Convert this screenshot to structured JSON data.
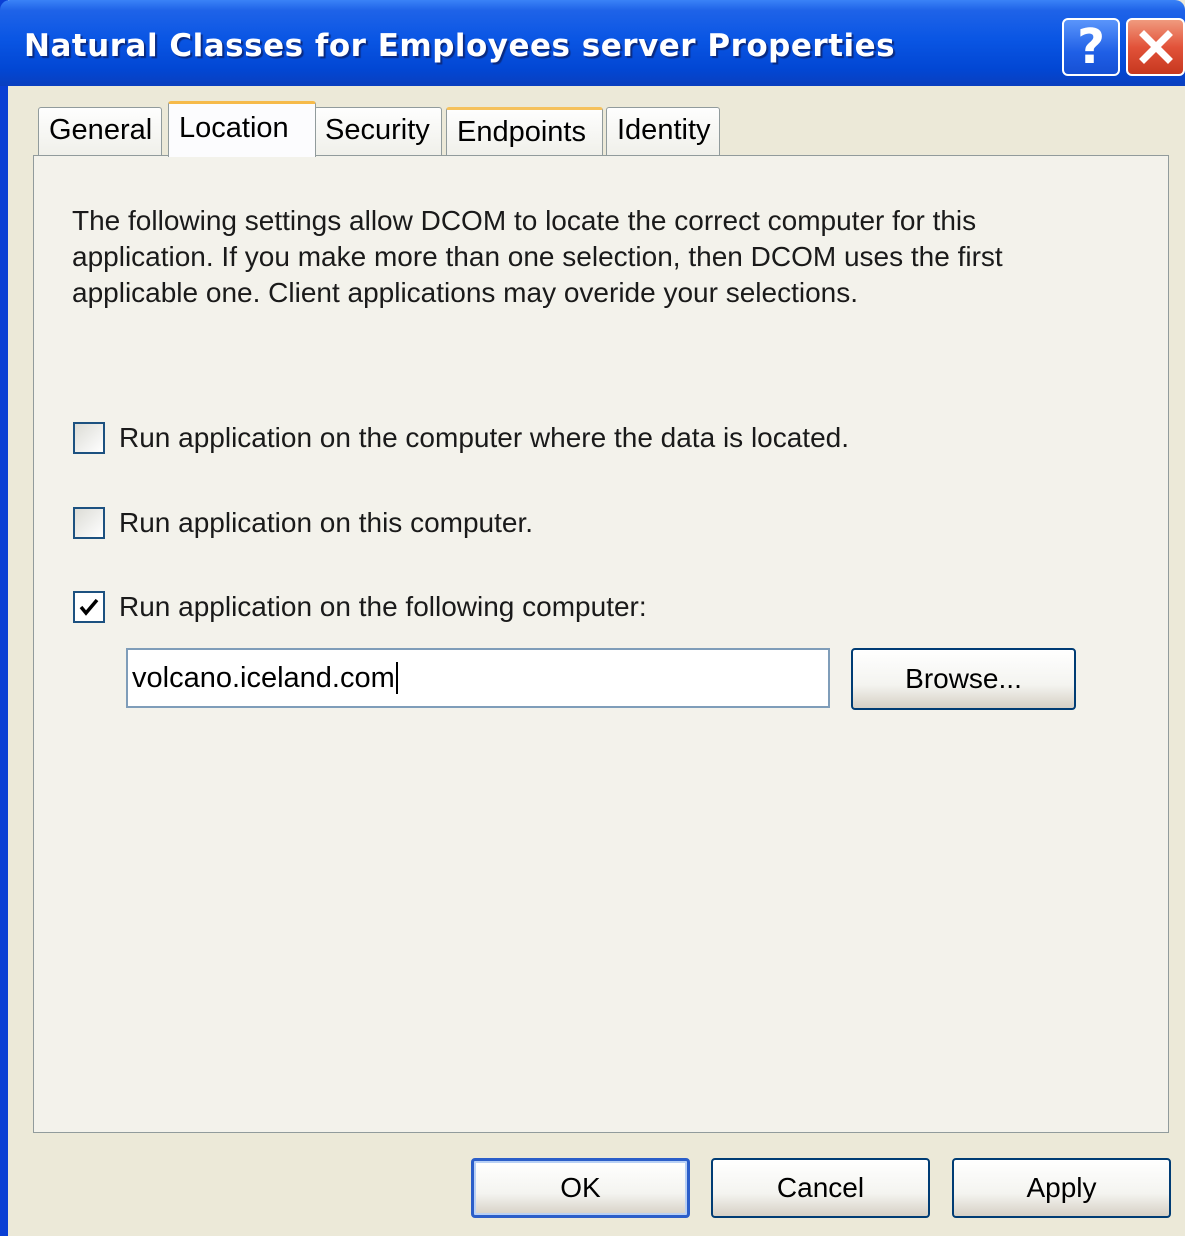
{
  "window": {
    "title": "Natural Classes for Employees server Properties",
    "help_glyph": "?",
    "close_icon": "close-icon"
  },
  "tabs": [
    {
      "label": "General",
      "active": false
    },
    {
      "label": "Location",
      "active": true
    },
    {
      "label": "Security",
      "active": false
    },
    {
      "label": "Endpoints",
      "active": false
    },
    {
      "label": "Identity",
      "active": false
    }
  ],
  "location": {
    "description": "The following settings allow DCOM to locate the correct computer for this application. If you make more than one selection, then DCOM uses the first applicable one. Client applications may overide your selections.",
    "options": [
      {
        "label": "Run application on the computer where the data is located.",
        "checked": false
      },
      {
        "label": "Run application on this computer.",
        "checked": false
      },
      {
        "label": "Run application on the following computer:",
        "checked": true
      }
    ],
    "computer_name": "volcano.iceland.com",
    "browse_label": "Browse..."
  },
  "buttons": {
    "ok": "OK",
    "cancel": "Cancel",
    "apply": "Apply"
  },
  "colors": {
    "titlebar": "#0a56e4",
    "dialog_bg": "#ece9d8",
    "tab_highlight": "#f6ba4a",
    "close_button": "#e2533a"
  }
}
